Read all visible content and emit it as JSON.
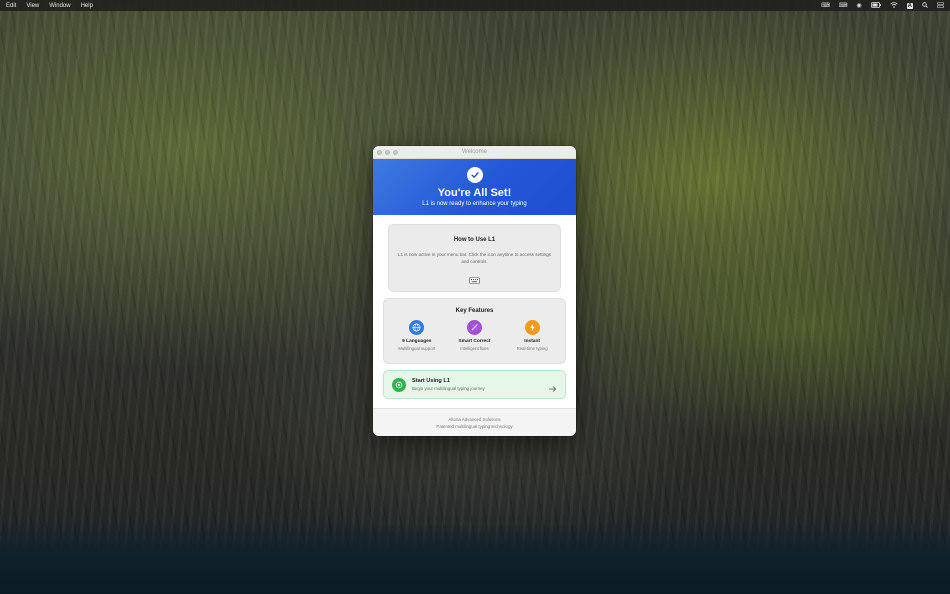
{
  "menubar": {
    "items": [
      "Edit",
      "View",
      "Window",
      "Help"
    ],
    "status_icons": [
      "keyboard-icon",
      "keyboard-icon",
      "play-icon",
      "battery-icon",
      "wifi-icon",
      "input-source-icon",
      "search-icon",
      "control-center-icon"
    ],
    "input_source_label": "A"
  },
  "window": {
    "title": "Welcome"
  },
  "hero": {
    "title": "You're All Set!",
    "subtitle": "L1 is now ready to enhance your typing",
    "color_start": "#3d7be0",
    "color_end": "#1f4ed1"
  },
  "howto": {
    "title": "How to Use L1",
    "text": "L1 is now active in your menu bar. Click the icon anytime to access settings and controls.",
    "icon": "keyboard-icon"
  },
  "features": {
    "title": "Key Features",
    "items": [
      {
        "name": "9 Languages",
        "desc": "Multilingual support",
        "icon": "globe-icon",
        "color": "#2d7be8"
      },
      {
        "name": "Smart Correct",
        "desc": "Intelligent fixes",
        "icon": "magic-wand-icon",
        "color": "#a24fd9"
      },
      {
        "name": "Instant",
        "desc": "Real-time typing",
        "icon": "lightning-icon",
        "color": "#f29a1c"
      }
    ]
  },
  "start": {
    "title": "Start Using L1",
    "subtitle": "Begin your multilingual typing journey",
    "color": "#2fb44e"
  },
  "footer": {
    "line1": "Altona Advanced Solutions",
    "line2": "Patented multilingual typing technology"
  }
}
